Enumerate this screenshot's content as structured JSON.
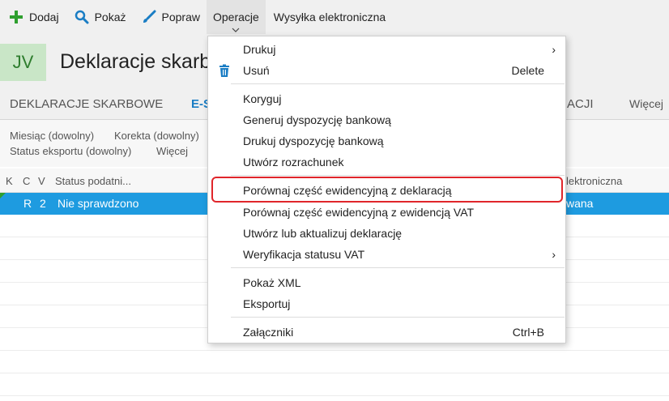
{
  "toolbar": {
    "items": [
      {
        "label": "Dodaj",
        "icon": "plus-icon"
      },
      {
        "label": "Pokaż",
        "icon": "magnifier-icon"
      },
      {
        "label": "Popraw",
        "icon": "brush-icon"
      },
      {
        "label": "Operacje"
      },
      {
        "label": "Wysyłka elektroniczna"
      }
    ]
  },
  "header": {
    "badge": "JV",
    "title": "Deklaracje skarbowe"
  },
  "tabs": {
    "t1": "DEKLARACJE SKARBOWE",
    "t2": "E-S",
    "t3": "ACJI",
    "more": "Więcej"
  },
  "filters": {
    "miesiac": "Miesiąc (dowolny)",
    "korekta": "Korekta (dowolny)",
    "status_eksportu": "Status eksportu (dowolny)",
    "wiecej": "Więcej"
  },
  "grid": {
    "columns": {
      "k": "K",
      "c": "C",
      "v": "V",
      "status": "Status podatni...",
      "elektr": "lektroniczna"
    },
    "rows": [
      {
        "c": "R",
        "v": "2",
        "status": "Nie sprawdzono",
        "elektr": "wana"
      }
    ]
  },
  "menu": {
    "items": [
      {
        "label": "Drukuj",
        "submenu": true
      },
      {
        "label": "Usuń",
        "shortcut": "Delete",
        "icon": "trash-icon"
      },
      {
        "label": "Koryguj"
      },
      {
        "label": "Generuj dyspozycję bankową"
      },
      {
        "label": "Drukuj dyspozycję bankową"
      },
      {
        "label": "Utwórz rozrachunek"
      },
      {
        "label": "Porównaj część ewidencyjną z deklaracją",
        "highlighted": true
      },
      {
        "label": "Porównaj część ewidencyjną z ewidencją VAT"
      },
      {
        "label": "Utwórz lub aktualizuj deklarację"
      },
      {
        "label": "Weryfikacja statusu VAT",
        "submenu": true
      },
      {
        "label": "Pokaż XML"
      },
      {
        "label": "Eksportuj"
      },
      {
        "label": "Załączniki",
        "shortcut": "Ctrl+B"
      }
    ],
    "arrow": "›"
  },
  "colors": {
    "accent": "#1a7dc4",
    "selection": "#1e9be0",
    "highlight_border": "#e0262b",
    "badge_bg": "#c9e6c7",
    "badge_fg": "#2e7d2e"
  }
}
